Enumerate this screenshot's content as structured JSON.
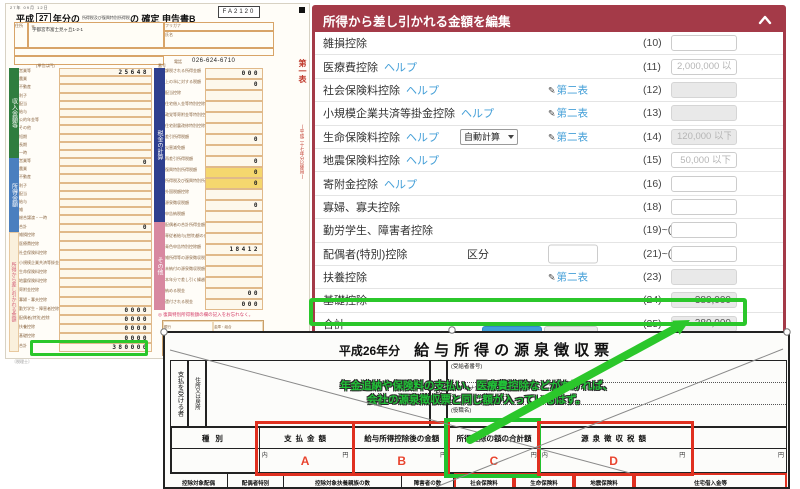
{
  "colors": {
    "panel_red": "#a43a48",
    "link_blue": "#46a0d8",
    "highlight_green": "#2bc72b",
    "box_red": "#e03020",
    "letter_red": "#e8442e",
    "annotation_green": "#21c137",
    "form_navy": "#2e3f8f",
    "form_green": "#2f7d3f",
    "form_blue": "#4a7fbf",
    "form_pink": "#d888a0",
    "accent_yellow": "#f5d76e",
    "button_blue": "#3f9fd8"
  },
  "icons": {
    "pencil": "✎"
  },
  "tax_form": {
    "stamp": "27年 09月 12日",
    "era": "平成",
    "year_box": "27",
    "title_mid": "年分の",
    "title_small": "所得税及び復興特別所得税",
    "title_end": "の 確定 申告書B",
    "code": "FA2120",
    "sheet": "第一表",
    "sheet_note": "(平成二十七年分以降用)",
    "addr_label": "住所",
    "addr_mark": "〒",
    "address": "宇都宮市富士見ヶ丘1-2-1",
    "furigana_label": "フリガナ",
    "name_label": "氏名",
    "phone_label": "電話",
    "phone": "026-624-6710",
    "unit": "(単位は円)",
    "number_label": "番号",
    "licensee": "〔税理士〕",
    "note": "◎ 復興特別所得税額の欄の記入をお忘れなく。",
    "sections": {
      "income": "収入金額等",
      "shotoku": "所得金額",
      "deduction": "所得から差し引かれる金額",
      "tax": "税金の計算",
      "other": "その他"
    },
    "bank_labels": [
      "銀行",
      "金庫・組合",
      "郵便局名等",
      "口座番号"
    ],
    "income_rows": [
      {
        "label": "営業等",
        "value": "25648"
      },
      {
        "label": "農業"
      },
      {
        "label": "不動産"
      },
      {
        "label": "利子"
      },
      {
        "label": "配当"
      },
      {
        "label": "給与"
      },
      {
        "label": "公的年金等"
      },
      {
        "label": "その他"
      },
      {
        "label": "短期"
      },
      {
        "label": "長期"
      },
      {
        "label": "一時"
      }
    ],
    "shotoku_rows": [
      {
        "label": "営業等",
        "value": "0"
      },
      {
        "label": "農業"
      },
      {
        "label": "不動産"
      },
      {
        "label": "利子"
      },
      {
        "label": "配当"
      },
      {
        "label": "給与"
      },
      {
        "label": "雑"
      },
      {
        "label": "総合譲渡・一時"
      },
      {
        "label": "合計",
        "value": "0"
      }
    ],
    "deduction_rows": [
      {
        "label": "雑損控除"
      },
      {
        "label": "医療費控除"
      },
      {
        "label": "社会保険料控除"
      },
      {
        "label": "小規模企業共済等掛金控除"
      },
      {
        "label": "生命保険料控除"
      },
      {
        "label": "地震保険料控除"
      },
      {
        "label": "寄附金控除"
      },
      {
        "label": "寡婦・寡夫控除"
      },
      {
        "label": "勤労学生・障害者控除",
        "value": "0000"
      },
      {
        "label": "配偶者(特別)控除",
        "value": "0000"
      },
      {
        "label": "扶養控除",
        "value": "0000"
      },
      {
        "label": "基礎控除",
        "value": "0000"
      },
      {
        "label": "合計",
        "value": "380000"
      }
    ],
    "tax_rows": [
      {
        "label": "課税される所得金額",
        "value": "000"
      },
      {
        "label": "上の㉖に対する税額",
        "value": "0"
      },
      {
        "label": "配当控除"
      },
      {
        "label": "住宅借入金等特別控除"
      },
      {
        "label": "政党等寄附金等特別控除"
      },
      {
        "label": "住宅耐震改修特別控除等"
      },
      {
        "label": "差引所得税額",
        "value": "0"
      },
      {
        "label": "災害減免額"
      },
      {
        "label": "再差引所得税額",
        "value": "0"
      },
      {
        "label": "復興特別所得税額",
        "value": "0",
        "cls": "yl"
      },
      {
        "label": "所得税及び復興特別所得税の額",
        "value": "0",
        "cls": "yl"
      },
      {
        "label": "外国税額控除"
      },
      {
        "label": "源泉徴収税額",
        "value": "0"
      },
      {
        "label": "申告納税額"
      }
    ],
    "other_rows": [
      {
        "label": "配偶者の合計所得金額"
      },
      {
        "label": "専従者給与(控除)額の合計額"
      },
      {
        "label": "青色申告特別控除額",
        "value": "18412"
      },
      {
        "label": "雑所得等の源泉徴収税額の合計額"
      },
      {
        "label": "未納付の源泉徴収税額"
      },
      {
        "label": "本年分で差し引く繰越損失額"
      },
      {
        "label": "納める税金",
        "value": "00"
      },
      {
        "label": "還付される税金",
        "value": "000"
      }
    ]
  },
  "panel": {
    "title": "所得から差し引かれる金額を編集",
    "rows": [
      {
        "label": "雑損控除",
        "num": "(10)"
      },
      {
        "label": "医療費控除",
        "help": "ヘルプ",
        "num": "(11)",
        "ph": "2,000,000 以下"
      },
      {
        "label": "社会保険料控除",
        "help": "ヘルプ",
        "sheet": "第二表",
        "num": "(12)",
        "cls": "dis"
      },
      {
        "label": "小規模企業共済等掛金控除",
        "help": "ヘルプ",
        "sheet": "第二表",
        "num": "(13)",
        "cls": "dis"
      },
      {
        "label": "生命保険料控除",
        "help": "ヘルプ",
        "select": "自動計算",
        "sheet": "第二表",
        "num": "(14)",
        "ph": "120,000 以下",
        "cls": "dis"
      },
      {
        "label": "地震保険料控除",
        "help": "ヘルプ",
        "num": "(15)",
        "ph": "50,000 以下"
      },
      {
        "label": "寄附金控除",
        "help": "ヘルプ",
        "num": "(16)"
      },
      {
        "label": "寡婦、寡夫控除",
        "num": "(18)"
      },
      {
        "label": "勤労学生、障害者控除",
        "num": "(19)~(20)"
      },
      {
        "label": "配偶者(特別)控除",
        "kubun": "区分",
        "num": "(21)~(22)"
      },
      {
        "label": "扶養控除",
        "sheet": "第二表",
        "num": "(23)",
        "cls": "dis"
      },
      {
        "label": "基礎控除",
        "num": "(24)",
        "value": "380,000",
        "cls": "dis"
      },
      {
        "label": "合計",
        "num": "(25)",
        "value": "380,000",
        "cls": "dis"
      }
    ]
  },
  "gensen": {
    "title_year": "平成26年分",
    "title": "給与所得の源泉徴収票",
    "payer_label": "支払を受ける者",
    "address_label": "住所又は居所",
    "name_label": "氏名",
    "recipient_no": "(受給者番号)",
    "furigana": "(フリガナ)",
    "role": "(役職名)",
    "annotation_line1": "年金追納や保険料の支払い、医療費控除などがなければ、",
    "annotation_line2": "会社の源泉徴収票と同じ額が入っているはず。",
    "columns": [
      {
        "label": "種別",
        "style": "width:88px;letter-spacing:6px"
      },
      {
        "label": "支払金額",
        "style": "width:96px;letter-spacing:4px",
        "mark_l": "内",
        "mark_r": "円",
        "letter": "A"
      },
      {
        "label": "給与所得控除後の金額",
        "style": "width:94px",
        "mark_r": "円",
        "letter": "B"
      },
      {
        "label": "所得控除の額の合計額",
        "style": "width:91px",
        "mark_r": "円",
        "letter": "C"
      },
      {
        "label": "源泉徴収税額",
        "style": "width:153px;letter-spacing:4px",
        "mark_l": "内",
        "mark_r": "円",
        "letter": "D"
      },
      {
        "label": "",
        "style": "width:95px",
        "mark_r": "円"
      }
    ],
    "bottom_cells": [
      {
        "label": "控除対象配偶",
        "style": "width:58px"
      },
      {
        "label": "配偶者特別",
        "style": "width:56px"
      },
      {
        "label": "控除対象扶養親族の数",
        "style": "width:118px"
      },
      {
        "label": "障害者の数",
        "style": "width:52px"
      },
      {
        "label": "社会保険料",
        "style": "width:60px",
        "cls": "redcell"
      },
      {
        "label": "生命保険料",
        "style": "width:60px",
        "cls": "redcell"
      },
      {
        "label": "地震保険料",
        "style": "width:60px",
        "cls": "redcell"
      },
      {
        "label": "住宅借入金等",
        "style": "width:153px",
        "cls": "redcell"
      }
    ]
  }
}
